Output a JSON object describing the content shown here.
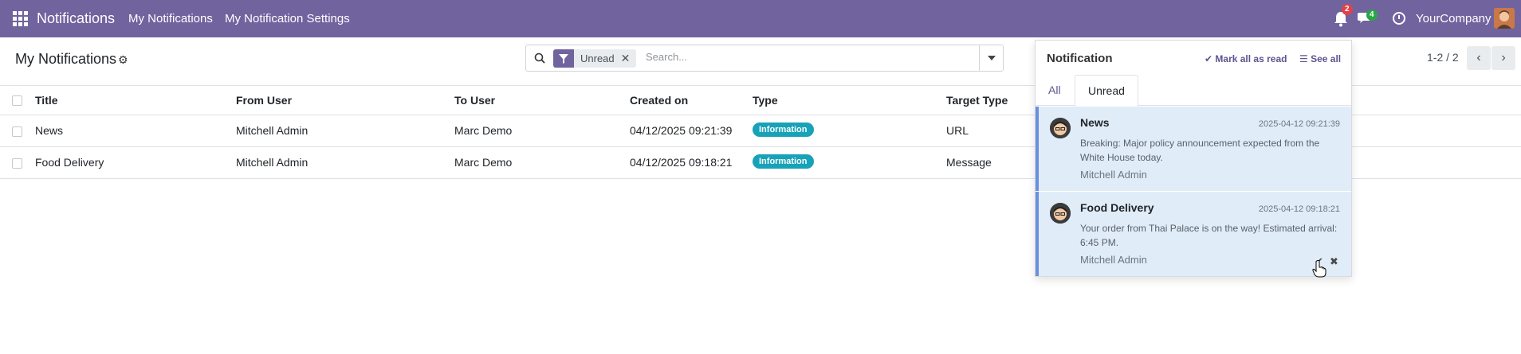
{
  "navbar": {
    "app_name": "Notifications",
    "menu": [
      "My Notifications",
      "My Notification Settings"
    ],
    "notification_count": "2",
    "message_count": "4",
    "company": "YourCompany",
    "color": "#71639e"
  },
  "control": {
    "title": "My Notifications",
    "facet_label": "Unread",
    "search_placeholder": "Search...",
    "pager": "1-2 / 2"
  },
  "table": {
    "columns": [
      "Title",
      "From User",
      "To User",
      "Created on",
      "Type",
      "Target Type"
    ],
    "rows": [
      {
        "title": "News",
        "from": "Mitchell Admin",
        "to": "Marc Demo",
        "created": "04/12/2025 09:21:39",
        "type": "Information",
        "target": "URL"
      },
      {
        "title": "Food Delivery",
        "from": "Mitchell Admin",
        "to": "Marc Demo",
        "created": "04/12/2025 09:18:21",
        "type": "Information",
        "target": "Message"
      }
    ]
  },
  "panel": {
    "title": "Notification",
    "mark_all": "Mark all as read",
    "see_all": "See all",
    "tabs": [
      "All",
      "Unread"
    ],
    "items": [
      {
        "title": "News",
        "time": "2025-04-12 09:21:39",
        "message": "Breaking: Major policy announcement expected from the White House today.",
        "author": "Mitchell Admin"
      },
      {
        "title": "Food Delivery",
        "time": "2025-04-12 09:18:21",
        "message": "Your order from Thai Palace is on the way! Estimated arrival: 6:45 PM.",
        "author": "Mitchell Admin"
      }
    ]
  }
}
